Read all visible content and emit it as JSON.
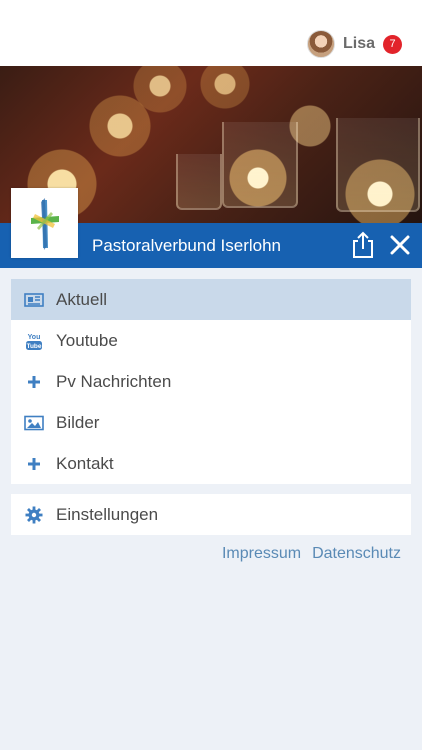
{
  "header": {
    "user_name": "Lisa",
    "notification_count": "7"
  },
  "banner": {
    "title": "Pastoralverbund Iserlohn"
  },
  "menu": {
    "items": [
      {
        "label": "Aktuell",
        "icon": "newspaper-icon",
        "active": true
      },
      {
        "label": "Youtube",
        "icon": "youtube-icon",
        "active": false
      },
      {
        "label": "Pv Nachrichten",
        "icon": "plus-icon",
        "active": false
      },
      {
        "label": "Bilder",
        "icon": "image-icon",
        "active": false
      },
      {
        "label": "Kontakt",
        "icon": "plus-icon",
        "active": false
      }
    ],
    "settings_label": "Einstellungen"
  },
  "footer": {
    "impressum": "Impressum",
    "datenschutz": "Datenschutz"
  },
  "colors": {
    "brand_blue": "#1761b1",
    "active_row": "#c9d9ea",
    "badge_red": "#e2232a",
    "link_blue": "#5a8ab5",
    "icon_blue": "#3f7fc2"
  }
}
